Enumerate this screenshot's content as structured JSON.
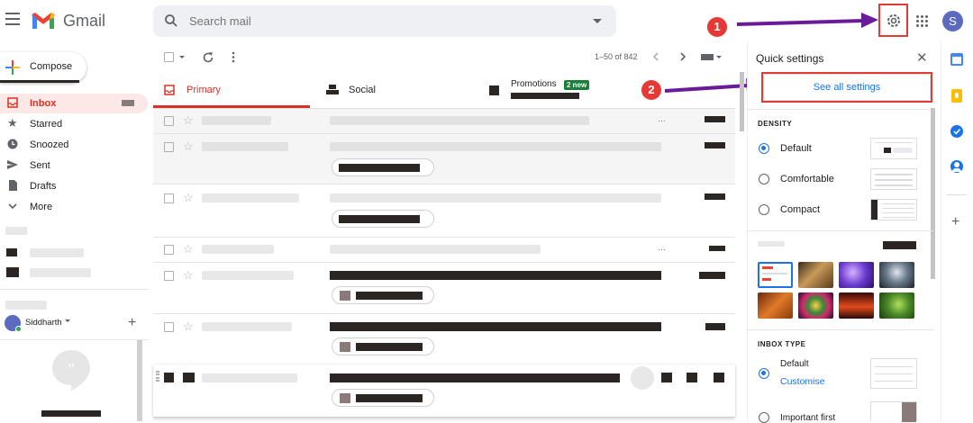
{
  "app": {
    "name": "Gmail"
  },
  "search": {
    "placeholder": "Search mail"
  },
  "user": {
    "avatar_letter": "S",
    "hangouts_name": "Siddharth"
  },
  "compose": {
    "label": "Compose"
  },
  "sidebar": {
    "items": [
      {
        "label": "Inbox",
        "icon": "inbox-icon"
      },
      {
        "label": "Starred",
        "icon": "star-icon"
      },
      {
        "label": "Snoozed",
        "icon": "clock-icon"
      },
      {
        "label": "Sent",
        "icon": "send-icon"
      },
      {
        "label": "Drafts",
        "icon": "draft-icon"
      },
      {
        "label": "More",
        "icon": "chevron-down-icon"
      }
    ]
  },
  "toolbar": {
    "pagination": "1–50 of 842"
  },
  "tabs": {
    "primary": "Primary",
    "social": "Social",
    "promotions": "Promotions",
    "promotions_badge": "2 new"
  },
  "quick_settings": {
    "title": "Quick settings",
    "see_all": "See all settings",
    "density": {
      "heading": "DENSITY",
      "options": [
        "Default",
        "Comfortable",
        "Compact"
      ],
      "selected": "Default"
    },
    "inbox_type": {
      "heading": "INBOX TYPE",
      "options": [
        "Default",
        "Important first"
      ],
      "customise": "Customise",
      "selected": "Default"
    }
  },
  "annotations": {
    "step1": "1",
    "step2": "2"
  },
  "colors": {
    "accent": "#1a73e8",
    "inbox_red": "#d93025",
    "annotation_red": "#e53935",
    "arrow_purple": "#6a1b9a",
    "badge_green": "#188038"
  }
}
